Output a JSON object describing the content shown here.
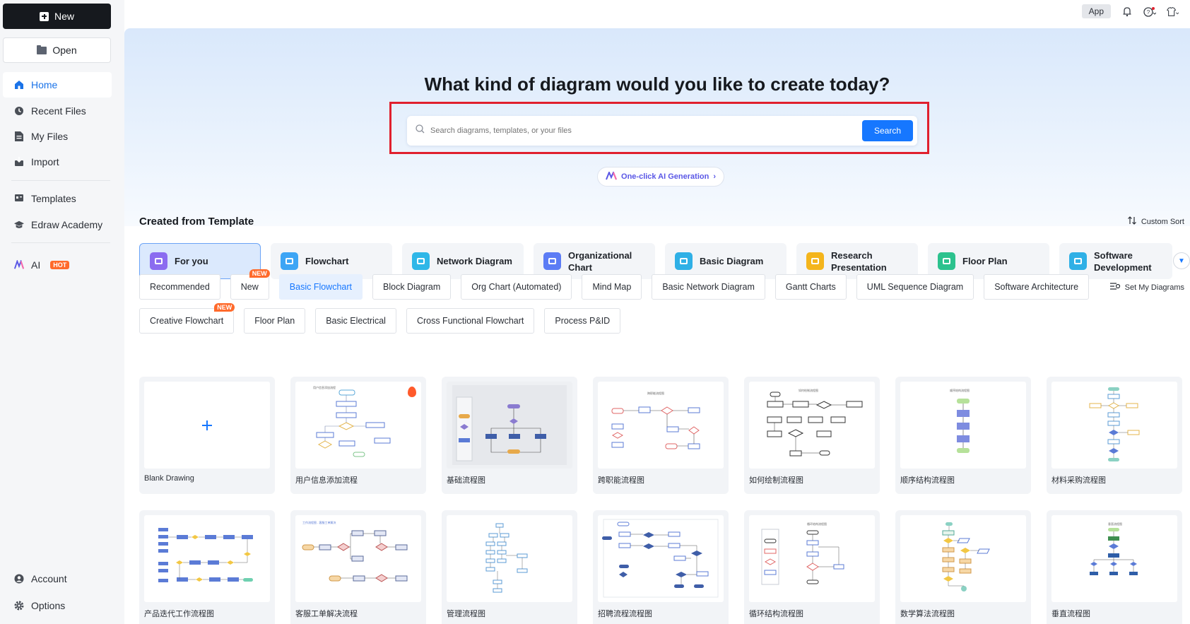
{
  "sidebar": {
    "new_label": "New",
    "open_label": "Open",
    "nav": [
      {
        "label": "Home",
        "icon": "home-icon"
      },
      {
        "label": "Recent Files",
        "icon": "clock-icon"
      },
      {
        "label": "My Files",
        "icon": "file-icon"
      },
      {
        "label": "Import",
        "icon": "import-icon"
      },
      {
        "label": "Templates",
        "icon": "templates-icon"
      },
      {
        "label": "Edraw Academy",
        "icon": "academy-icon"
      },
      {
        "label": "AI",
        "icon": "ai-icon",
        "badge": "HOT"
      },
      {
        "label": "Account",
        "icon": "account-icon"
      },
      {
        "label": "Options",
        "icon": "gear-icon"
      }
    ]
  },
  "topbar": {
    "app_label": "App"
  },
  "hero": {
    "title": "What kind of diagram would you like to create today?",
    "search_placeholder": "Search diagrams, templates, or your files",
    "search_button": "Search",
    "ai_generation": "One-click AI Generation"
  },
  "section": {
    "title": "Created from Template",
    "custom_sort": "Custom Sort",
    "set_my_diagrams": "Set My Diagrams"
  },
  "categories": [
    {
      "label": "For you",
      "color": "#8b6cf0"
    },
    {
      "label": "Flowchart",
      "color": "#3da5f5"
    },
    {
      "label": "Network Diagram",
      "color": "#2fb7e8"
    },
    {
      "label": "Organizational Chart",
      "color": "#5c7cf5"
    },
    {
      "label": "Basic Diagram",
      "color": "#2fb0e6"
    },
    {
      "label": "Research Presentation",
      "color": "#f4b51c"
    },
    {
      "label": "Floor Plan",
      "color": "#2cc28e"
    },
    {
      "label": "Software Development",
      "color": "#2fb0e6"
    }
  ],
  "pills_row1": [
    {
      "label": "Recommended"
    },
    {
      "label": "New",
      "tag": "NEW"
    },
    {
      "label": "Basic Flowchart"
    },
    {
      "label": "Block Diagram"
    },
    {
      "label": "Org Chart (Automated)"
    },
    {
      "label": "Mind Map"
    },
    {
      "label": "Basic Network Diagram"
    },
    {
      "label": "Gantt Charts"
    },
    {
      "label": "UML Sequence Diagram"
    },
    {
      "label": "Software Architecture"
    }
  ],
  "pills_row2": [
    {
      "label": "Creative Flowchart",
      "tag": "NEW"
    },
    {
      "label": "Floor Plan"
    },
    {
      "label": "Basic Electrical"
    },
    {
      "label": "Cross Functional Flowchart"
    },
    {
      "label": "Process P&ID"
    }
  ],
  "templates": [
    {
      "name": "Blank Drawing"
    },
    {
      "name": "用户信息添加流程"
    },
    {
      "name": "基础流程图"
    },
    {
      "name": "跨职能流程图"
    },
    {
      "name": "如何绘制流程图"
    },
    {
      "name": "顺序结构流程图"
    },
    {
      "name": "材料采购流程图"
    },
    {
      "name": "产品迭代工作流程图"
    },
    {
      "name": "客服工单解决流程"
    },
    {
      "name": "管理流程图"
    },
    {
      "name": "招聘流程流程图"
    },
    {
      "name": "循环结构流程图"
    },
    {
      "name": "数学算法流程图"
    },
    {
      "name": "垂直流程图"
    }
  ],
  "colors": {
    "accent": "#1677ff",
    "highlight_frame": "#e0202e",
    "hot_badge": "#ff6a2b"
  }
}
